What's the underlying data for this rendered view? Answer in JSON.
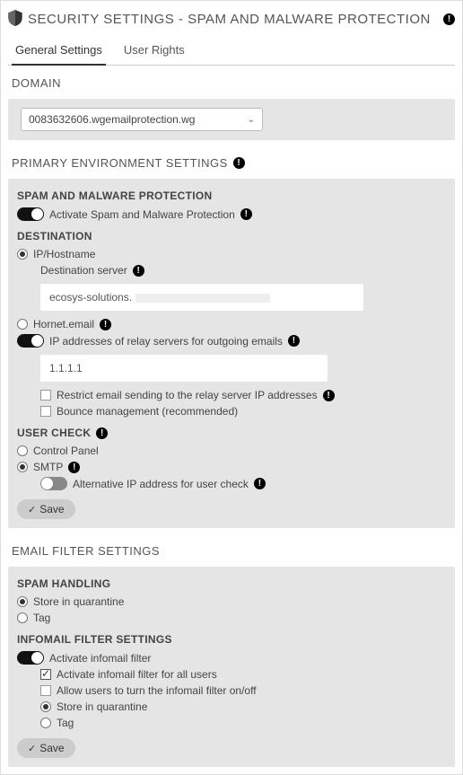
{
  "header": {
    "title": "SECURITY SETTINGS - SPAM AND MALWARE PROTECTION"
  },
  "tabs": {
    "general": "General Settings",
    "user_rights": "User Rights"
  },
  "domain": {
    "title": "DOMAIN",
    "selected": "0083632606.wgemailprotection.wg"
  },
  "primary": {
    "title": "PRIMARY ENVIRONMENT SETTINGS",
    "spam_title": "SPAM AND MALWARE PROTECTION",
    "activate_label": "Activate Spam and Malware Protection",
    "destination_title": "DESTINATION",
    "ip_hostname_label": "IP/Hostname",
    "destination_server_label": "Destination server",
    "destination_server_value": "ecosys-solutions.",
    "hornet_label": "Hornet.email",
    "relay_label": "IP addresses of relay servers for outgoing emails",
    "relay_value": "1.1.1.1",
    "restrict_label": "Restrict email sending to the relay server IP addresses",
    "bounce_label": "Bounce management (recommended)",
    "usercheck_title": "USER CHECK",
    "control_panel_label": "Control Panel",
    "smtp_label": "SMTP",
    "alt_ip_label": "Alternative IP address for user check",
    "save_label": "Save"
  },
  "email_filter": {
    "title": "EMAIL FILTER SETTINGS",
    "spam_handling_title": "SPAM HANDLING",
    "store_label": "Store in quarantine",
    "tag_label": "Tag",
    "infomail_title": "INFOMAIL FILTER SETTINGS",
    "activate_infomail_label": "Activate infomail filter",
    "activate_all_users_label": "Activate infomail filter for all users",
    "allow_users_toggle_label": "Allow users to turn the infomail filter on/off",
    "infomail_store_label": "Store in quarantine",
    "infomail_tag_label": "Tag",
    "save_label": "Save"
  }
}
